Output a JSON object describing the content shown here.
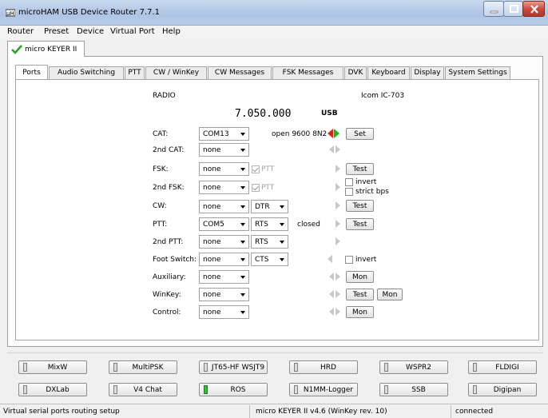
{
  "window": {
    "title": "microHAM USB Device Router 7.7.1"
  },
  "menu": [
    "Router",
    "Preset",
    "Device",
    "Virtual Port",
    "Help"
  ],
  "device_tab": {
    "label": "micro KEYER II"
  },
  "tabs": [
    "Ports",
    "Audio Switching",
    "PTT",
    "CW / WinKey",
    "CW Messages",
    "FSK Messages",
    "DVK",
    "Keyboard",
    "Display",
    "System Settings"
  ],
  "radio": {
    "label": "RADIO",
    "model": "Icom IC-703",
    "frequency": "7.050.000",
    "mode": "USB"
  },
  "ports": {
    "cat": {
      "label": "CAT:",
      "value": "COM13",
      "status": "open 9600 8N2",
      "button": "Set"
    },
    "cat2": {
      "label": "2nd CAT:",
      "value": "none"
    },
    "fsk": {
      "label": "FSK:",
      "value": "none",
      "ptt_label": "PTT",
      "button": "Test"
    },
    "fsk2": {
      "label": "2nd FSK:",
      "value": "none",
      "ptt_label": "PTT",
      "invert_label": "invert",
      "strict_label": "strict bps"
    },
    "cw": {
      "label": "CW:",
      "value": "none",
      "line": "DTR",
      "button": "Test"
    },
    "ptt": {
      "label": "PTT:",
      "value": "COM5",
      "line": "RTS",
      "status": "closed",
      "button": "Test"
    },
    "ptt2": {
      "label": "2nd PTT:",
      "value": "none",
      "line": "RTS"
    },
    "foot": {
      "label": "Foot Switch:",
      "value": "none",
      "line": "CTS",
      "invert_label": "invert"
    },
    "aux": {
      "label": "Auxiliary:",
      "value": "none",
      "button": "Mon"
    },
    "winkey": {
      "label": "WinKey:",
      "value": "none",
      "button1": "Test",
      "button2": "Mon"
    },
    "control": {
      "label": "Control:",
      "value": "none",
      "button": "Mon"
    }
  },
  "apps": [
    {
      "label": "MixW",
      "active": false
    },
    {
      "label": "MultiPSK",
      "active": false
    },
    {
      "label": "JT65-HF WSJT9",
      "active": false
    },
    {
      "label": "HRD",
      "active": false
    },
    {
      "label": "WSPR2",
      "active": false
    },
    {
      "label": "FLDIGI",
      "active": false
    },
    {
      "label": "DXLab",
      "active": false
    },
    {
      "label": "V4 Chat",
      "active": false
    },
    {
      "label": "ROS",
      "active": true
    },
    {
      "label": "N1MM-Logger",
      "active": false
    },
    {
      "label": "SSB",
      "active": false
    },
    {
      "label": "Digipan",
      "active": false
    }
  ],
  "status": {
    "left": "Virtual serial ports routing setup",
    "middle": "micro KEYER II v4.6 (WinKey rev. 10)",
    "right": "connected"
  },
  "colors": {
    "led_on": "#2ec52e",
    "arrow_rx": "#e02020",
    "arrow_tx": "#20b020"
  }
}
